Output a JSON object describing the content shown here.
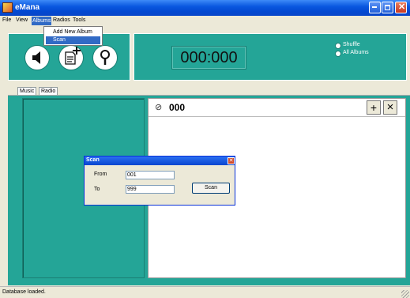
{
  "window": {
    "title": "eMana",
    "status": "Database loaded."
  },
  "menubar": [
    "File",
    "View",
    "Albums",
    "Radios",
    "Tools"
  ],
  "albums_menu": {
    "items": [
      "Add New Album",
      "Scan"
    ],
    "selected": "Scan"
  },
  "player": {
    "counter": "000:000",
    "options": [
      {
        "label": "Shuffle"
      },
      {
        "label": "All Albums"
      }
    ],
    "buttons": [
      "volume-icon",
      "add-note-icon",
      "search-icon"
    ]
  },
  "tabs": [
    "Music",
    "Radio"
  ],
  "album": {
    "title": "000",
    "add": "+",
    "remove": "×"
  },
  "scan_dialog": {
    "title": "Scan",
    "from_label": "From",
    "from_value": "001",
    "to_label": "To",
    "to_value": "999",
    "button": "Scan"
  },
  "colors": {
    "accent": "#24a597",
    "titlebar": "#0a58e0"
  }
}
